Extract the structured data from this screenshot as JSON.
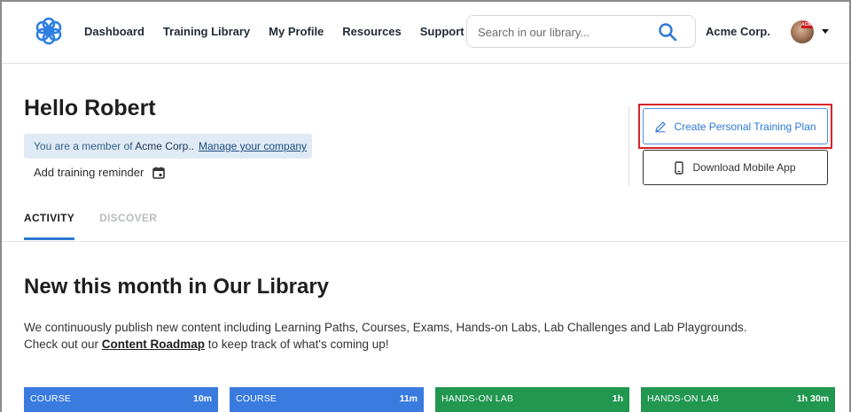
{
  "header": {
    "nav": [
      {
        "label": "Dashboard"
      },
      {
        "label": "Training Library"
      },
      {
        "label": "My Profile"
      },
      {
        "label": "Resources"
      },
      {
        "label": "Support"
      }
    ],
    "search_placeholder": "Search in our library...",
    "company_name": "Acme Corp.",
    "avatar_badge": "ACME"
  },
  "greeting": {
    "title": "Hello Robert",
    "member_prefix": "You are a member of ",
    "member_company": "Acme Corp..",
    "manage_link": "Manage your company",
    "reminder": "Add training reminder"
  },
  "actions": {
    "create_plan": "Create Personal Training Plan",
    "download_app": "Download Mobile App"
  },
  "tabs": [
    {
      "label": "ACTIVITY",
      "active": true
    },
    {
      "label": "DISCOVER",
      "active": false
    }
  ],
  "section": {
    "title": "New this month in Our Library",
    "desc_before": "We continuously publish new content including Learning Paths, Courses, Exams, Hands-on Labs, Lab Challenges and Lab Playgrounds. Check out our ",
    "desc_link": "Content Roadmap",
    "desc_after": " to keep track of what's coming up!"
  },
  "cards": [
    {
      "type": "COURSE",
      "duration": "10m",
      "color": "#3a7be0"
    },
    {
      "type": "COURSE",
      "duration": "11m",
      "color": "#3a7be0"
    },
    {
      "type": "HANDS-ON LAB",
      "duration": "1h",
      "color": "#229750"
    },
    {
      "type": "HANDS-ON LAB",
      "duration": "1h 30m",
      "color": "#229750"
    }
  ],
  "colors": {
    "accent": "#2d79d4",
    "highlight": "#d9222a",
    "banner_bg": "#dfeaf4"
  }
}
